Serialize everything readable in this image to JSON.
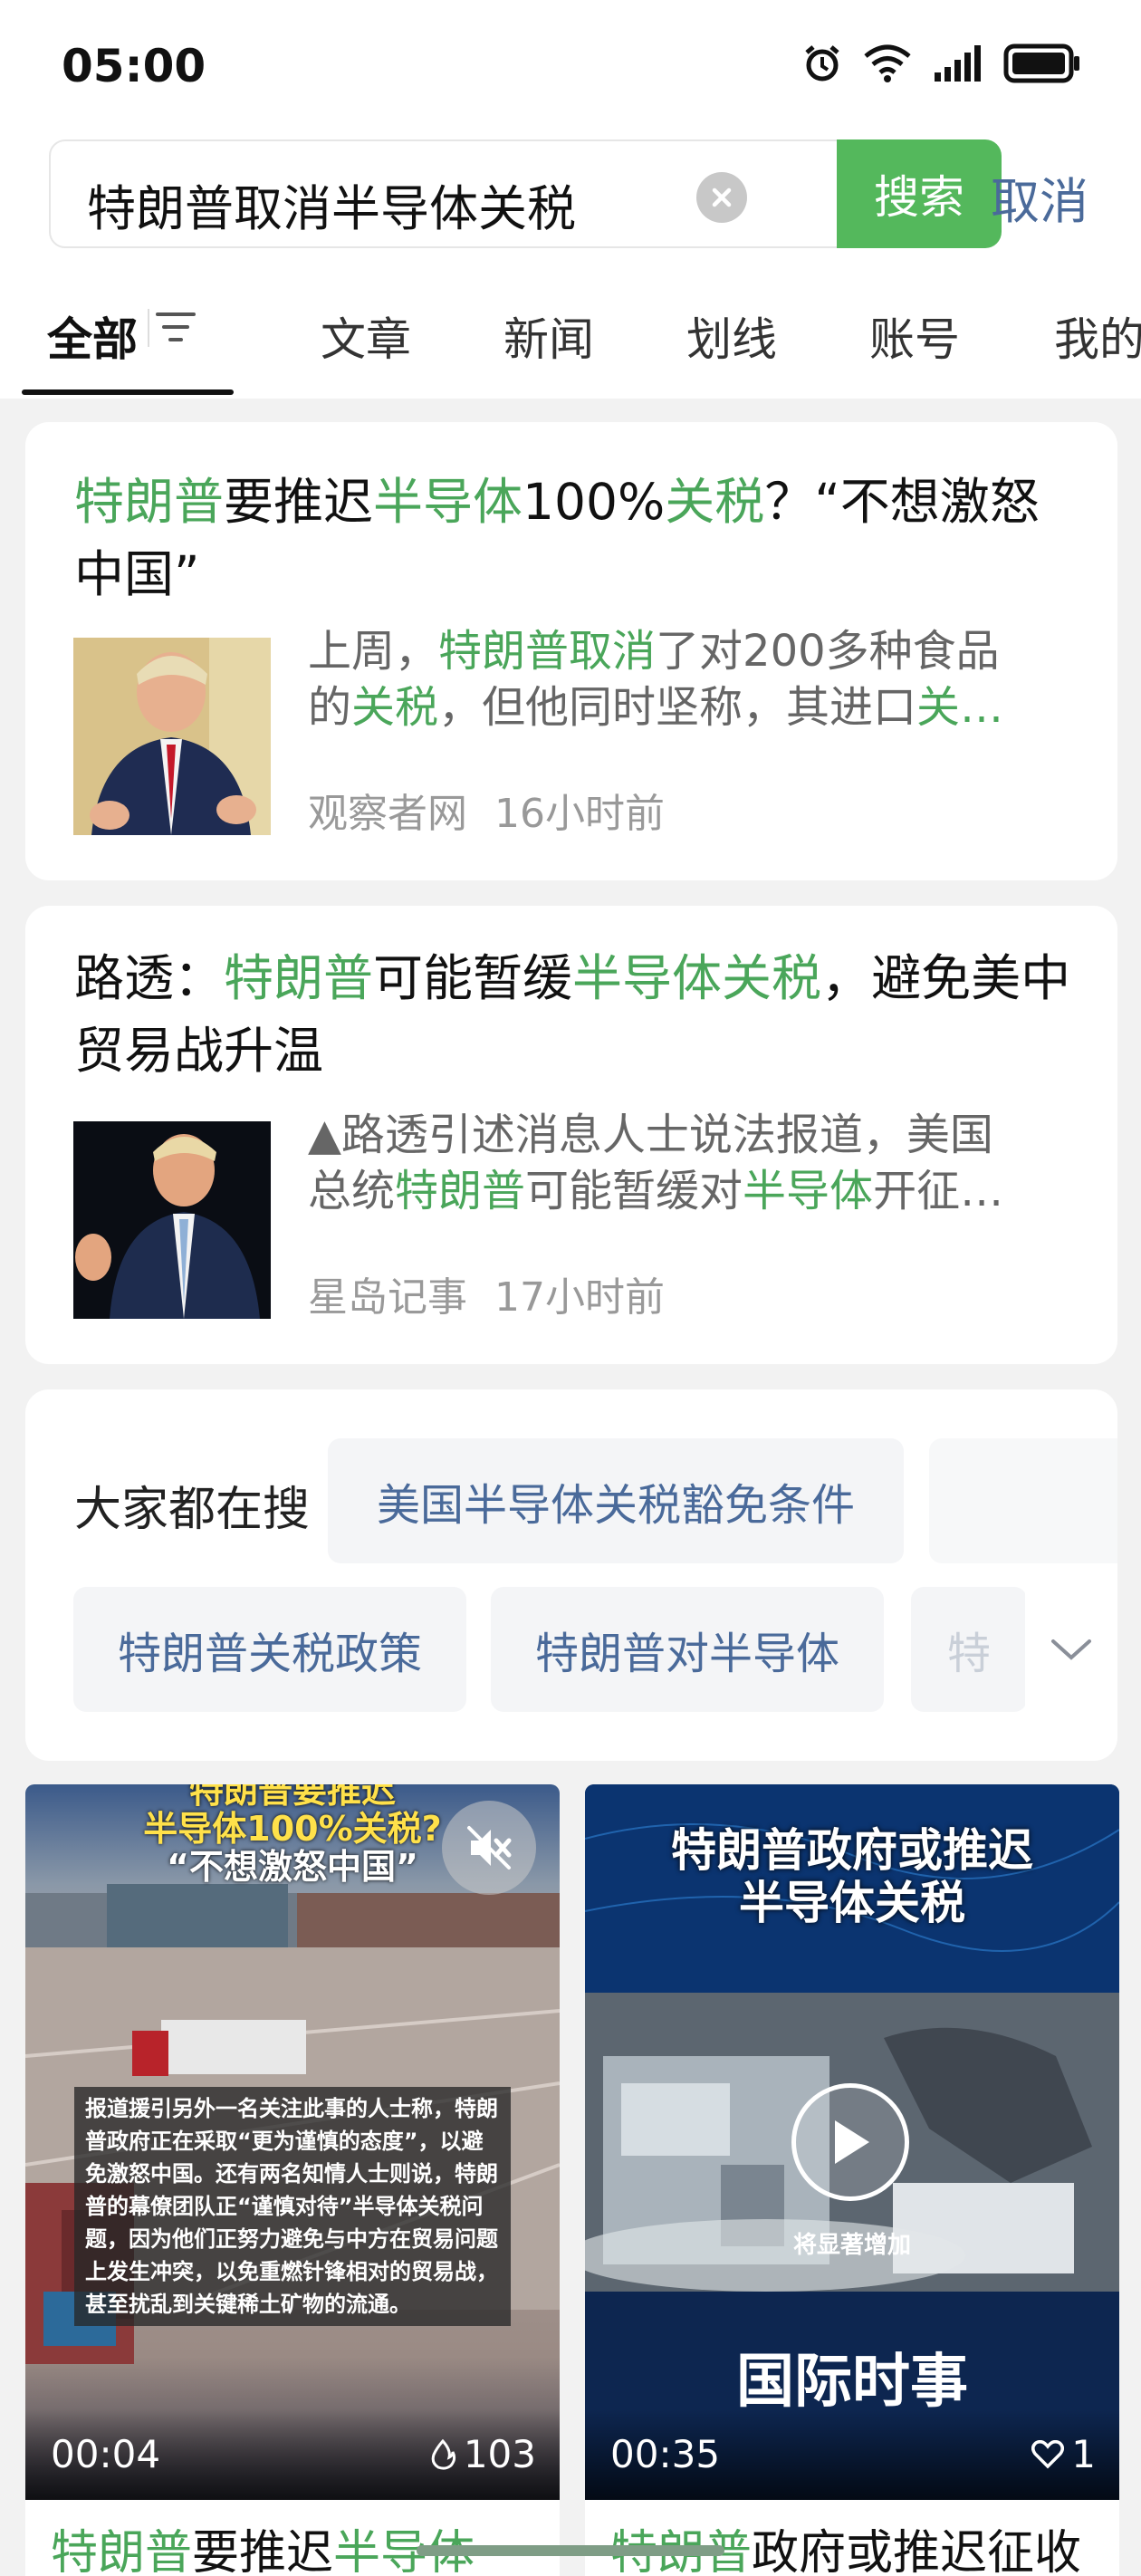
{
  "status_bar": {
    "time": "05:00"
  },
  "search": {
    "query": "特朗普取消半导体关税",
    "search_label": "搜索",
    "cancel_label": "取消"
  },
  "tabs": [
    {
      "label": "全部"
    },
    {
      "label": "文章"
    },
    {
      "label": "新闻"
    },
    {
      "label": "划线"
    },
    {
      "label": "账号"
    },
    {
      "label": "我的"
    }
  ],
  "results": [
    {
      "title_parts": [
        {
          "t": "特朗普",
          "hl": true
        },
        {
          "t": "要推迟",
          "hl": false
        },
        {
          "t": "半导体",
          "hl": true
        },
        {
          "t": "100%",
          "hl": false
        },
        {
          "t": "关税",
          "hl": true
        },
        {
          "t": "？“不想激怒中国”",
          "hl": false
        }
      ],
      "snippet_lines": [
        [
          {
            "t": "上周，",
            "hl": false
          },
          {
            "t": "特朗普取消",
            "hl": true
          },
          {
            "t": "了对200多种食品",
            "hl": false
          }
        ],
        [
          {
            "t": "的",
            "hl": false
          },
          {
            "t": "关税",
            "hl": true
          },
          {
            "t": "，但他同时坚称，其进口",
            "hl": false
          },
          {
            "t": "关…",
            "hl": true
          }
        ]
      ],
      "source": "观察者网",
      "time": "16小时前"
    },
    {
      "title_parts": [
        {
          "t": "路透：",
          "hl": false
        },
        {
          "t": "特朗普",
          "hl": true
        },
        {
          "t": "可能暂缓",
          "hl": false
        },
        {
          "t": "半导体关税",
          "hl": true
        },
        {
          "t": "，避免美中贸易战升温",
          "hl": false
        }
      ],
      "snippet_lines": [
        [
          {
            "t": "▲路透引述消息人士说法报道，美国",
            "hl": false
          }
        ],
        [
          {
            "t": "总统",
            "hl": false
          },
          {
            "t": "特朗普",
            "hl": true
          },
          {
            "t": "可能暂缓对",
            "hl": false
          },
          {
            "t": "半导体",
            "hl": true
          },
          {
            "t": "开征…",
            "hl": false
          }
        ]
      ],
      "source": "星岛记事",
      "time": "17小时前"
    }
  ],
  "popular": {
    "label": "大家都在搜",
    "chips": [
      "美国半导体关税豁免条件",
      "特朗普关税政策",
      "特朗普对半导体",
      "特"
    ]
  },
  "videos": [
    {
      "overlay_title_top": "特朗普要推迟",
      "overlay_title_1": "半导体100%关税?",
      "overlay_title_2": "“不想激怒中国”",
      "caption": "报道援引另外一名关注此事的人士称，特朗普政府正在采取“更为谨慎的态度”，以避免激怒中国。还有两名知情人士则说，特朗普的幕僚团队正“谨慎对待”半导体关税问题，因为他们正努力避免与中方在贸易问题上发生冲突，以免重燃针锋相对的贸易战，甚至扰乱到关键稀土矿物的流通。",
      "duration": "00:04",
      "count": "103",
      "title_parts": [
        {
          "t": "特朗普",
          "hl": true
        },
        {
          "t": "要推迟",
          "hl": false
        },
        {
          "t": "半导体",
          "hl": true
        }
      ]
    },
    {
      "overlay_title_1": "特朗普政府或推迟",
      "overlay_title_2": "半导体关税",
      "mid_text": "将显著增加",
      "bottom_text": "国际时事",
      "duration": "00:35",
      "count": "1",
      "title_parts": [
        {
          "t": "特朗普",
          "hl": true
        },
        {
          "t": "政府或推迟征收",
          "hl": false
        }
      ]
    }
  ],
  "colors": {
    "accent": "#54b85c",
    "highlight": "#4aa65a",
    "link_blue": "#4a6a9a"
  }
}
